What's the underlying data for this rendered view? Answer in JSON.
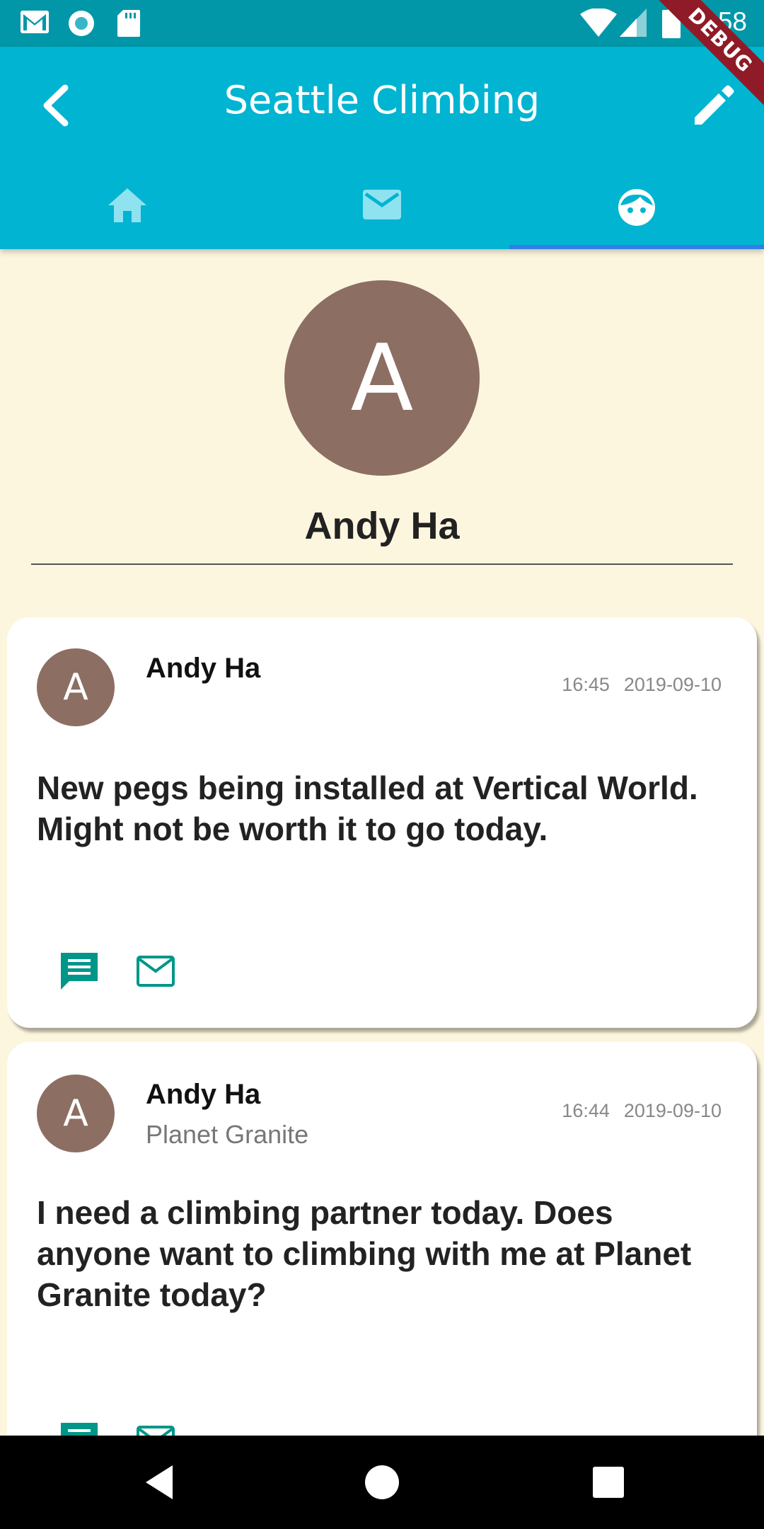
{
  "status_bar": {
    "time": "4:58",
    "icons": [
      "gmail-icon",
      "sync-icon",
      "sd-card-icon",
      "wifi-icon",
      "signal-icon",
      "battery-icon"
    ]
  },
  "app_bar": {
    "title": "Seattle Climbing",
    "tabs": [
      {
        "icon": "home-icon"
      },
      {
        "icon": "mail-icon"
      },
      {
        "icon": "face-icon",
        "selected": true
      }
    ]
  },
  "debug_banner": "DEBUG",
  "profile": {
    "initial": "A",
    "name": "Andy Ha"
  },
  "posts": [
    {
      "initial": "A",
      "author": "Andy Ha",
      "location": "",
      "time": "16:45",
      "date": "2019-09-10",
      "body": "New pegs being installed at Vertical World. Might not be worth it to go today."
    },
    {
      "initial": "A",
      "author": "Andy Ha",
      "location": "Planet Granite",
      "time": "16:44",
      "date": "2019-09-10",
      "body": "I need a climbing partner today. Does anyone want to climbing with me at Planet Granite today?"
    }
  ],
  "colors": {
    "app_bar": "#00b4d2",
    "status_bar": "#0197a8",
    "background": "#fdf6df",
    "avatar": "#8d6e63",
    "action_icon": "#009688",
    "tab_indicator": "#2f7fe6"
  }
}
